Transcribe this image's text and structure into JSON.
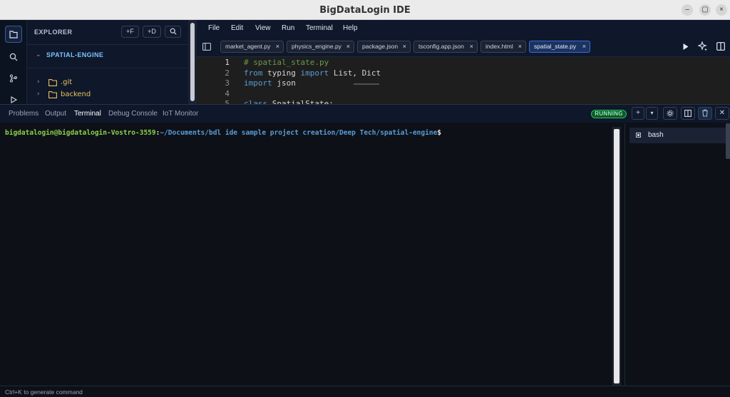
{
  "window": {
    "title": "BigDataLogin IDE",
    "controls": {
      "minimize": "–",
      "maximize": "▢",
      "close": "×"
    }
  },
  "activity_bar": {
    "icons": [
      "files-icon",
      "search-icon",
      "source-control-icon",
      "run-icon"
    ]
  },
  "explorer": {
    "header": "EXPLORER",
    "buttons": {
      "new_file": "+F",
      "new_dir": "+D"
    },
    "section": "SPATIAL-ENGINE",
    "items": [
      {
        "name": ".git",
        "icon": "folder-icon"
      },
      {
        "name": "backend",
        "icon": "folder-icon"
      }
    ]
  },
  "menu": [
    "File",
    "Edit",
    "View",
    "Run",
    "Terminal",
    "Help"
  ],
  "tabs": [
    {
      "label": "market_agent.py"
    },
    {
      "label": "physics_engine.py"
    },
    {
      "label": "package.json"
    },
    {
      "label": "tsconfig.app.json"
    },
    {
      "label": "index.html"
    },
    {
      "label": "spatial_state.py",
      "active": true
    }
  ],
  "code": {
    "lines": [
      {
        "num": "1",
        "parts": [
          {
            "t": "# spatial_state.py",
            "c": "comment"
          }
        ]
      },
      {
        "num": "2",
        "parts": [
          {
            "t": "from",
            "c": "kw"
          },
          {
            "t": " typing ",
            "c": "plain"
          },
          {
            "t": "import",
            "c": "kw"
          },
          {
            "t": " List, Dict",
            "c": "plain"
          }
        ]
      },
      {
        "num": "3",
        "parts": [
          {
            "t": "import",
            "c": "kw"
          },
          {
            "t": " json",
            "c": "plain"
          }
        ]
      },
      {
        "num": "4",
        "parts": []
      },
      {
        "num": "5",
        "parts": [
          {
            "t": "class",
            "c": "kw"
          },
          {
            "t": " SpatialState:",
            "c": "plain"
          }
        ]
      }
    ]
  },
  "panel": {
    "tabs": [
      "Problems",
      "Output",
      "Terminal",
      "Debug Console",
      "IoT Monitor"
    ],
    "active_tab": "Terminal",
    "status": "RUNNING",
    "buttons": {
      "add": "+",
      "dropdown": "▾",
      "settings": "⚙",
      "split": "◫",
      "trash": "🗑",
      "close": "✕"
    }
  },
  "terminal": {
    "user": "bigdatalogin@bigdatalogin-Vostro-3559",
    "separator": ":",
    "path": "~/Documents/bdl ide sample project creation/Deep Tech/spatial-engine",
    "symbol": "$"
  },
  "sessions": [
    {
      "name": "bash"
    }
  ],
  "status_bar": {
    "hint": "Ctrl+K to generate command"
  },
  "colors": {
    "accent": "#3b6bd0",
    "running": "#22c55e",
    "folder": "#e6c15a"
  }
}
